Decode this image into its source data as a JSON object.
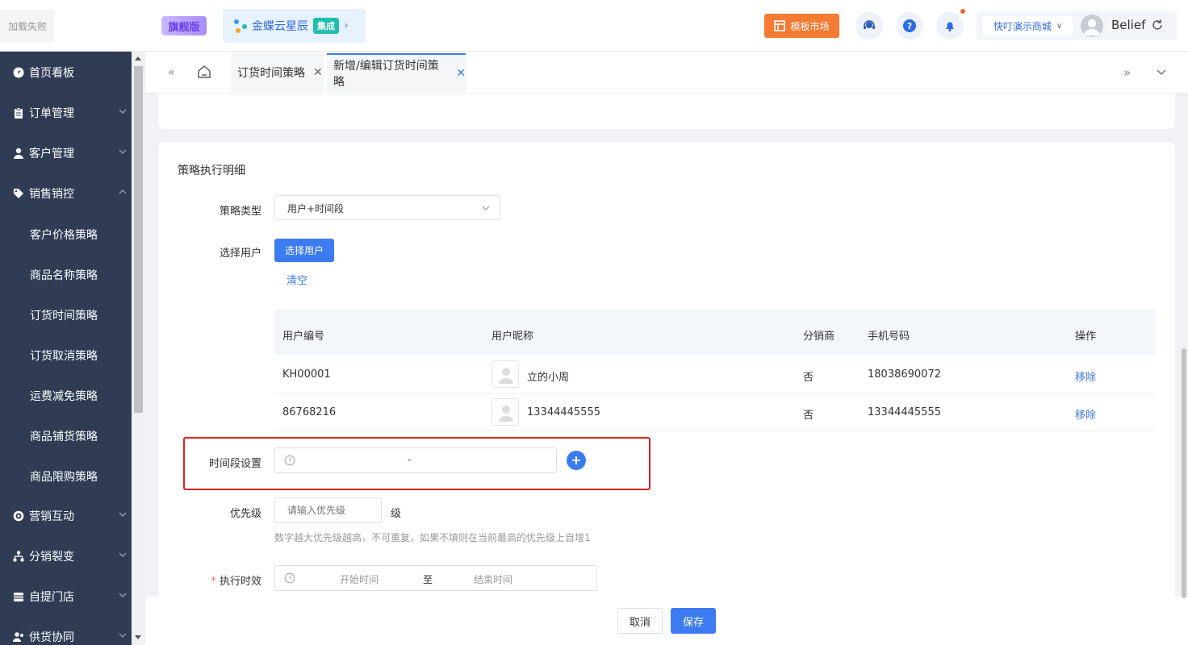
{
  "header": {
    "logo_text": "加载失败",
    "edition_badge": "旗舰版",
    "product_name": "金蝶云星辰",
    "product_tag": "集成",
    "template_market": "模板市场",
    "store_name": "快叮演示商城",
    "user_name": "Belief"
  },
  "sidebar": {
    "items": [
      {
        "label": "首页看板",
        "icon": "navigation-icon"
      },
      {
        "label": "订单管理",
        "icon": "clipboard-icon"
      },
      {
        "label": "客户管理",
        "icon": "user-icon"
      },
      {
        "label": "销售销控",
        "icon": "tag-icon"
      },
      {
        "label": "营销互动",
        "icon": "target-icon"
      },
      {
        "label": "分销裂变",
        "icon": "hierarchy-icon"
      },
      {
        "label": "自提门店",
        "icon": "store-icon"
      },
      {
        "label": "供货协同",
        "icon": "users-icon"
      }
    ],
    "subitems": [
      "客户价格策略",
      "商品名称策略",
      "订货时间策略",
      "订货取消策略",
      "运费减免策略",
      "商品铺货策略",
      "商品限购策略"
    ]
  },
  "tabs": [
    {
      "label": "订货时间策略"
    },
    {
      "label": "新增/编辑订货时间策略"
    }
  ],
  "section": {
    "title": "策略执行明细",
    "strategy_type_label": "策略类型",
    "strategy_type_value": "用户+时间段",
    "select_user_label": "选择用户",
    "select_user_button": "选择用户",
    "clear_link": "清空",
    "time_slot_label": "时间段设置",
    "time_slot_separator": "-",
    "priority_label": "优先级",
    "priority_placeholder": "请输入优先级",
    "priority_unit": "级",
    "priority_hint": "数字越大优先级越高，不可重复，如果不填则在当前最高的优先级上自增1",
    "required_mark": "*",
    "validity_label": "执行时效",
    "start_placeholder": "开始时间",
    "range_sep": "至",
    "end_placeholder": "结束时间"
  },
  "table": {
    "headers": [
      "用户编号",
      "用户昵称",
      "分销商",
      "手机号码",
      "操作"
    ],
    "rows": [
      {
        "id": "KH00001",
        "nickname": "立的小周",
        "distributor": "否",
        "phone": "18038690072",
        "action": "移除"
      },
      {
        "id": "86768216",
        "nickname": "13344445555",
        "distributor": "否",
        "phone": "13344445555",
        "action": "移除"
      }
    ]
  },
  "footer": {
    "cancel": "取消",
    "save": "保存"
  },
  "colors": {
    "primary": "#3c7cf0",
    "sidebar_bg": "#2f3c54",
    "highlight": "#e02020",
    "orange": "#f57a32"
  }
}
